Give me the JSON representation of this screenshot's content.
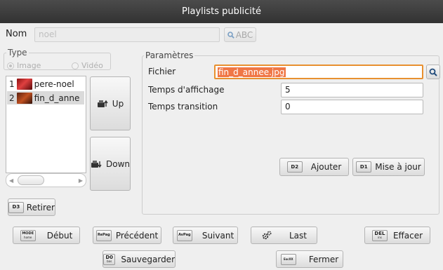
{
  "window": {
    "title": "Playlists publicité"
  },
  "nom": {
    "label": "Nom",
    "value": "noel",
    "abc_label": "ABC"
  },
  "type": {
    "label": "Type",
    "option_image": "Image",
    "option_video": "Vidéo",
    "selected": "Image"
  },
  "items": [
    {
      "index": "1",
      "name": "pere-noel"
    },
    {
      "index": "2",
      "name": "fin_d_anne"
    }
  ],
  "side_buttons": {
    "up": "Up",
    "down": "Down"
  },
  "retirer": {
    "key": "D3",
    "label": "Retirer"
  },
  "parametres": {
    "label": "Paramètres",
    "fichier_label": "Fichier",
    "fichier_value": "fin_d_annee.jpg",
    "temps_affichage_label": "Temps d'affichage",
    "temps_affichage_value": "5",
    "temps_transition_label": "Temps transition",
    "temps_transition_value": "0"
  },
  "actions": {
    "ajouter": {
      "key": "D2",
      "label": "Ajouter"
    },
    "mise_a_jour": {
      "key": "D1",
      "label": "Mise à jour"
    }
  },
  "nav": {
    "debut": {
      "key": "MODE",
      "key_sub": "home",
      "label": "Début"
    },
    "precedent": {
      "key": "RePag",
      "label": "Précédent"
    },
    "suivant": {
      "key": "AvPag",
      "label": "Suivant"
    },
    "last": {
      "label": "Last"
    },
    "effacer": {
      "key": "DEL",
      "key_sub": "ins",
      "label": "Effacer"
    },
    "sauvegarder": {
      "key": "D0",
      "key_sub": "bas",
      "label": "Sauvegarder"
    },
    "fermer": {
      "key": "EscXX",
      "label": "Fermer"
    }
  },
  "colors": {
    "titlebar": "#3a3a3a",
    "selection": "#f07746",
    "focus_border": "#e8902f",
    "list_selected": "#dadada"
  },
  "icons": {
    "search": "magnifier-icon",
    "abc_search": "magnifier-icon",
    "up": "printer-up-icon",
    "down": "printer-down-icon",
    "last": "gears-icon"
  }
}
